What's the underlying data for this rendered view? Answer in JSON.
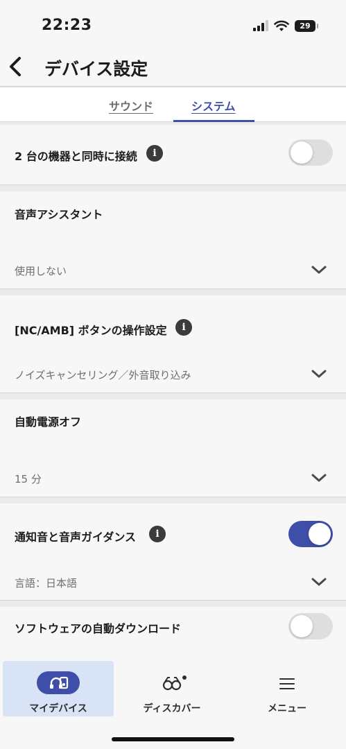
{
  "status_bar": {
    "time": "22:23",
    "battery": "29"
  },
  "header": {
    "title": "デバイス設定"
  },
  "tabs": [
    {
      "label": "サウンド",
      "active": false
    },
    {
      "label": "システム",
      "active": true
    }
  ],
  "settings": {
    "multipoint": {
      "label": "2 台の機器と同時に接続",
      "enabled": false
    },
    "voice_assistant": {
      "label": "音声アシスタント",
      "value": "使用しない"
    },
    "nc_amb_button": {
      "label": "[NC/AMB] ボタンの操作設定",
      "value": "ノイズキャンセリング／外音取り込み"
    },
    "auto_power_off": {
      "label": "自動電源オフ",
      "value": "15 分"
    },
    "notification_voice": {
      "label": "通知音と音声ガイダンス",
      "enabled": true,
      "value": "言語：日本語"
    },
    "auto_download": {
      "label": "ソフトウェアの自動ダウンロード",
      "enabled": false
    }
  },
  "bottom_nav": {
    "items": [
      {
        "label": "マイデバイス",
        "icon": "headphones-device-icon",
        "active": true
      },
      {
        "label": "ディスカバー",
        "icon": "binoculars-icon",
        "active": false
      },
      {
        "label": "メニュー",
        "icon": "hamburger-menu-icon",
        "active": false
      }
    ]
  },
  "colors": {
    "accent": "#3f4ea8",
    "background": "#f7f7f7",
    "active_nav_bg": "#d8e3f5"
  }
}
